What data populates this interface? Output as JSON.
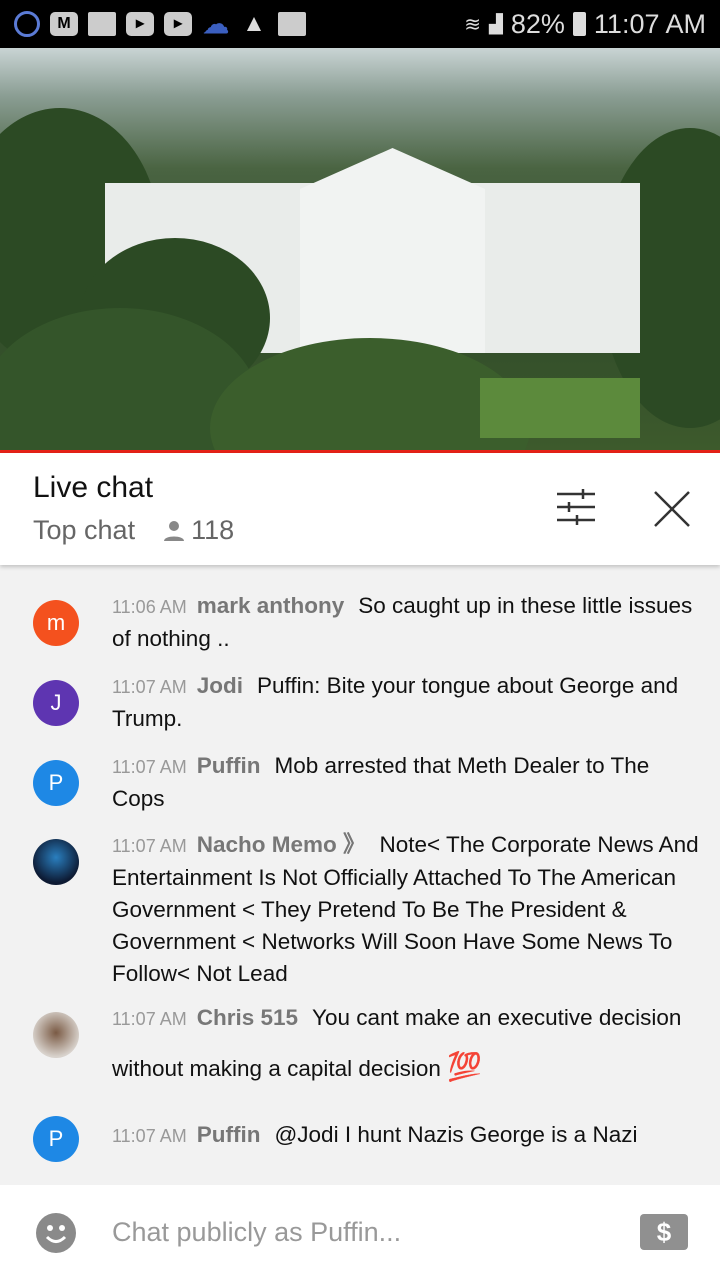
{
  "status_bar": {
    "battery": "82%",
    "time": "11:07 AM",
    "icons": [
      "pokeball-icon",
      "m-app-icon",
      "folder-icon",
      "youtube-icon",
      "youtube-icon",
      "cloud-icon",
      "warning-icon",
      "image-icon",
      "wifi-icon",
      "signal-icon",
      "battery-icon"
    ]
  },
  "video": {
    "subject": "white-house-live-camera"
  },
  "header": {
    "title": "Live chat",
    "mode": "Top chat",
    "viewers": "118"
  },
  "messages": [
    {
      "avatar": "m",
      "color": "#f4511e",
      "time": "11:06 AM",
      "author": "mark anthony",
      "text": "So caught up in these little issues of nothing .."
    },
    {
      "avatar": "J",
      "color": "#5e35b1",
      "time": "11:07 AM",
      "author": "Jodi",
      "text": "Puffin: Bite your tongue about George and Trump."
    },
    {
      "avatar": "P",
      "color": "#1e88e5",
      "time": "11:07 AM",
      "author": "Puffin",
      "text": "Mob arrested that Meth Dealer to The Cops"
    },
    {
      "avatar": "",
      "color": "#1a2a4a",
      "time": "11:07 AM",
      "author": "Nacho Memo 》",
      "text": "Note< The Corporate News And Entertainment Is Not Officially Attached To The American Government < They Pretend To Be The President & Government < Networks Will Soon Have Some News To Follow< Not Lead"
    },
    {
      "avatar": "",
      "color": "#c9b8a8",
      "time": "11:07 AM",
      "author": "Chris 515",
      "text": "You cant make an executive decision without making a capital decision",
      "emoji": "💯"
    },
    {
      "avatar": "P",
      "color": "#1e88e5",
      "time": "11:07 AM",
      "author": "Puffin",
      "text": "@Jodi I hunt Nazis George is a Nazi"
    }
  ],
  "input": {
    "placeholder": "Chat publicly as Puffin...",
    "superchat": "$"
  }
}
